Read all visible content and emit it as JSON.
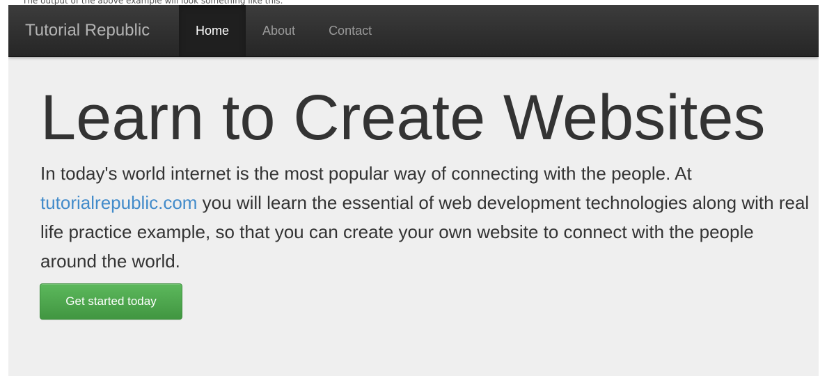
{
  "caption": "The output of the above example will look something like this:",
  "navbar": {
    "brand": "Tutorial Republic",
    "items": [
      {
        "label": "Home",
        "active": true
      },
      {
        "label": "About",
        "active": false
      },
      {
        "label": "Contact",
        "active": false
      }
    ]
  },
  "jumbotron": {
    "title": "Learn to Create Websites",
    "lead_before_link": "In today's world internet is the most popular way of connecting with the people. At ",
    "lead_link": "tutorialrepublic.com",
    "lead_after_link": " you will learn the essential of web development technologies along with real life practice example, so that you can create your own website to connect with the people around the world.",
    "button_label": "Get started today"
  },
  "colors": {
    "navbar_bg": "#2b2b2b",
    "page_bg": "#efefef",
    "link": "#428bca",
    "button": "#4cae4c",
    "text": "#333333"
  }
}
